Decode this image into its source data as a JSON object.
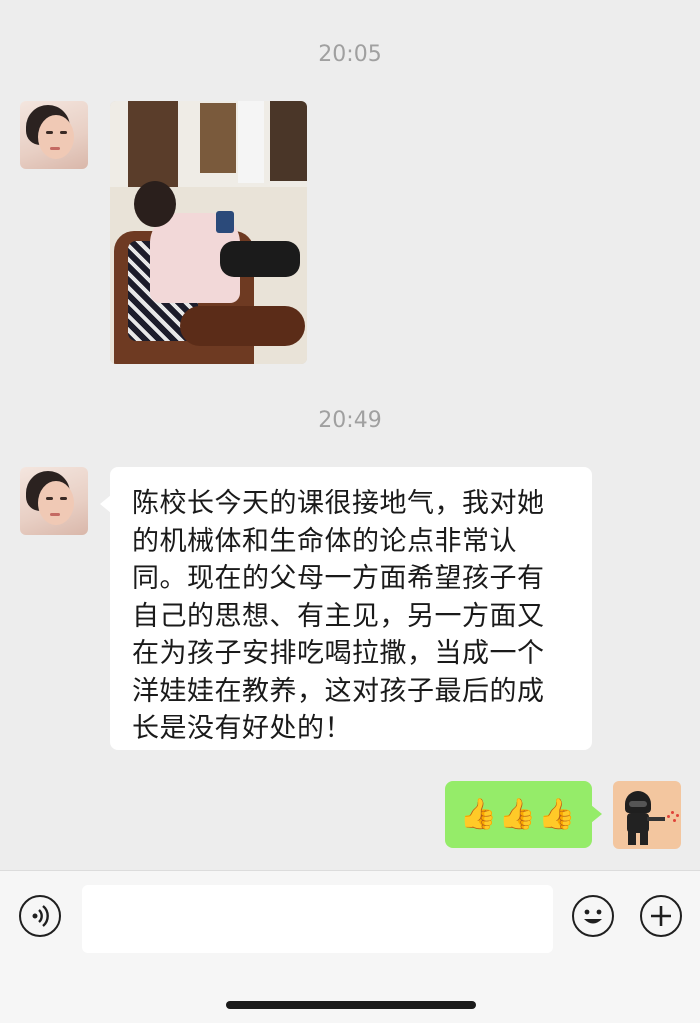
{
  "messages": [
    {
      "timestamp": "20:05",
      "sender": "contact",
      "type": "image",
      "avatar_icon": "woman-avatar-icon"
    },
    {
      "timestamp": "20:49",
      "sender": "contact",
      "type": "text",
      "avatar_icon": "woman-avatar-icon",
      "lines": [
        "陈校长今天的课很接地气，我对她",
        "的机械体和生命体的论点非常认",
        "同。现在的父母一方面希望孩子有",
        "自己的思想、有主见，另一方面又",
        "在为孩子安排吃喝拉撒，当成一个",
        "洋娃娃在教养，这对孩子最后的成",
        "长是没有好处的！"
      ]
    },
    {
      "sender": "me",
      "type": "emoji",
      "text": "👍👍👍",
      "avatar_icon": "soldier-avatar-icon",
      "bubble_color": "#95ec69"
    }
  ],
  "input_bar": {
    "voice_icon": "voice-icon",
    "text_value": "",
    "emoji_icon": "emoji-icon",
    "more_icon": "plus-icon"
  },
  "colors": {
    "background": "#ededed",
    "incoming_bubble": "#ffffff",
    "outgoing_bubble": "#95ec69",
    "timestamp": "#a0a0a0"
  }
}
